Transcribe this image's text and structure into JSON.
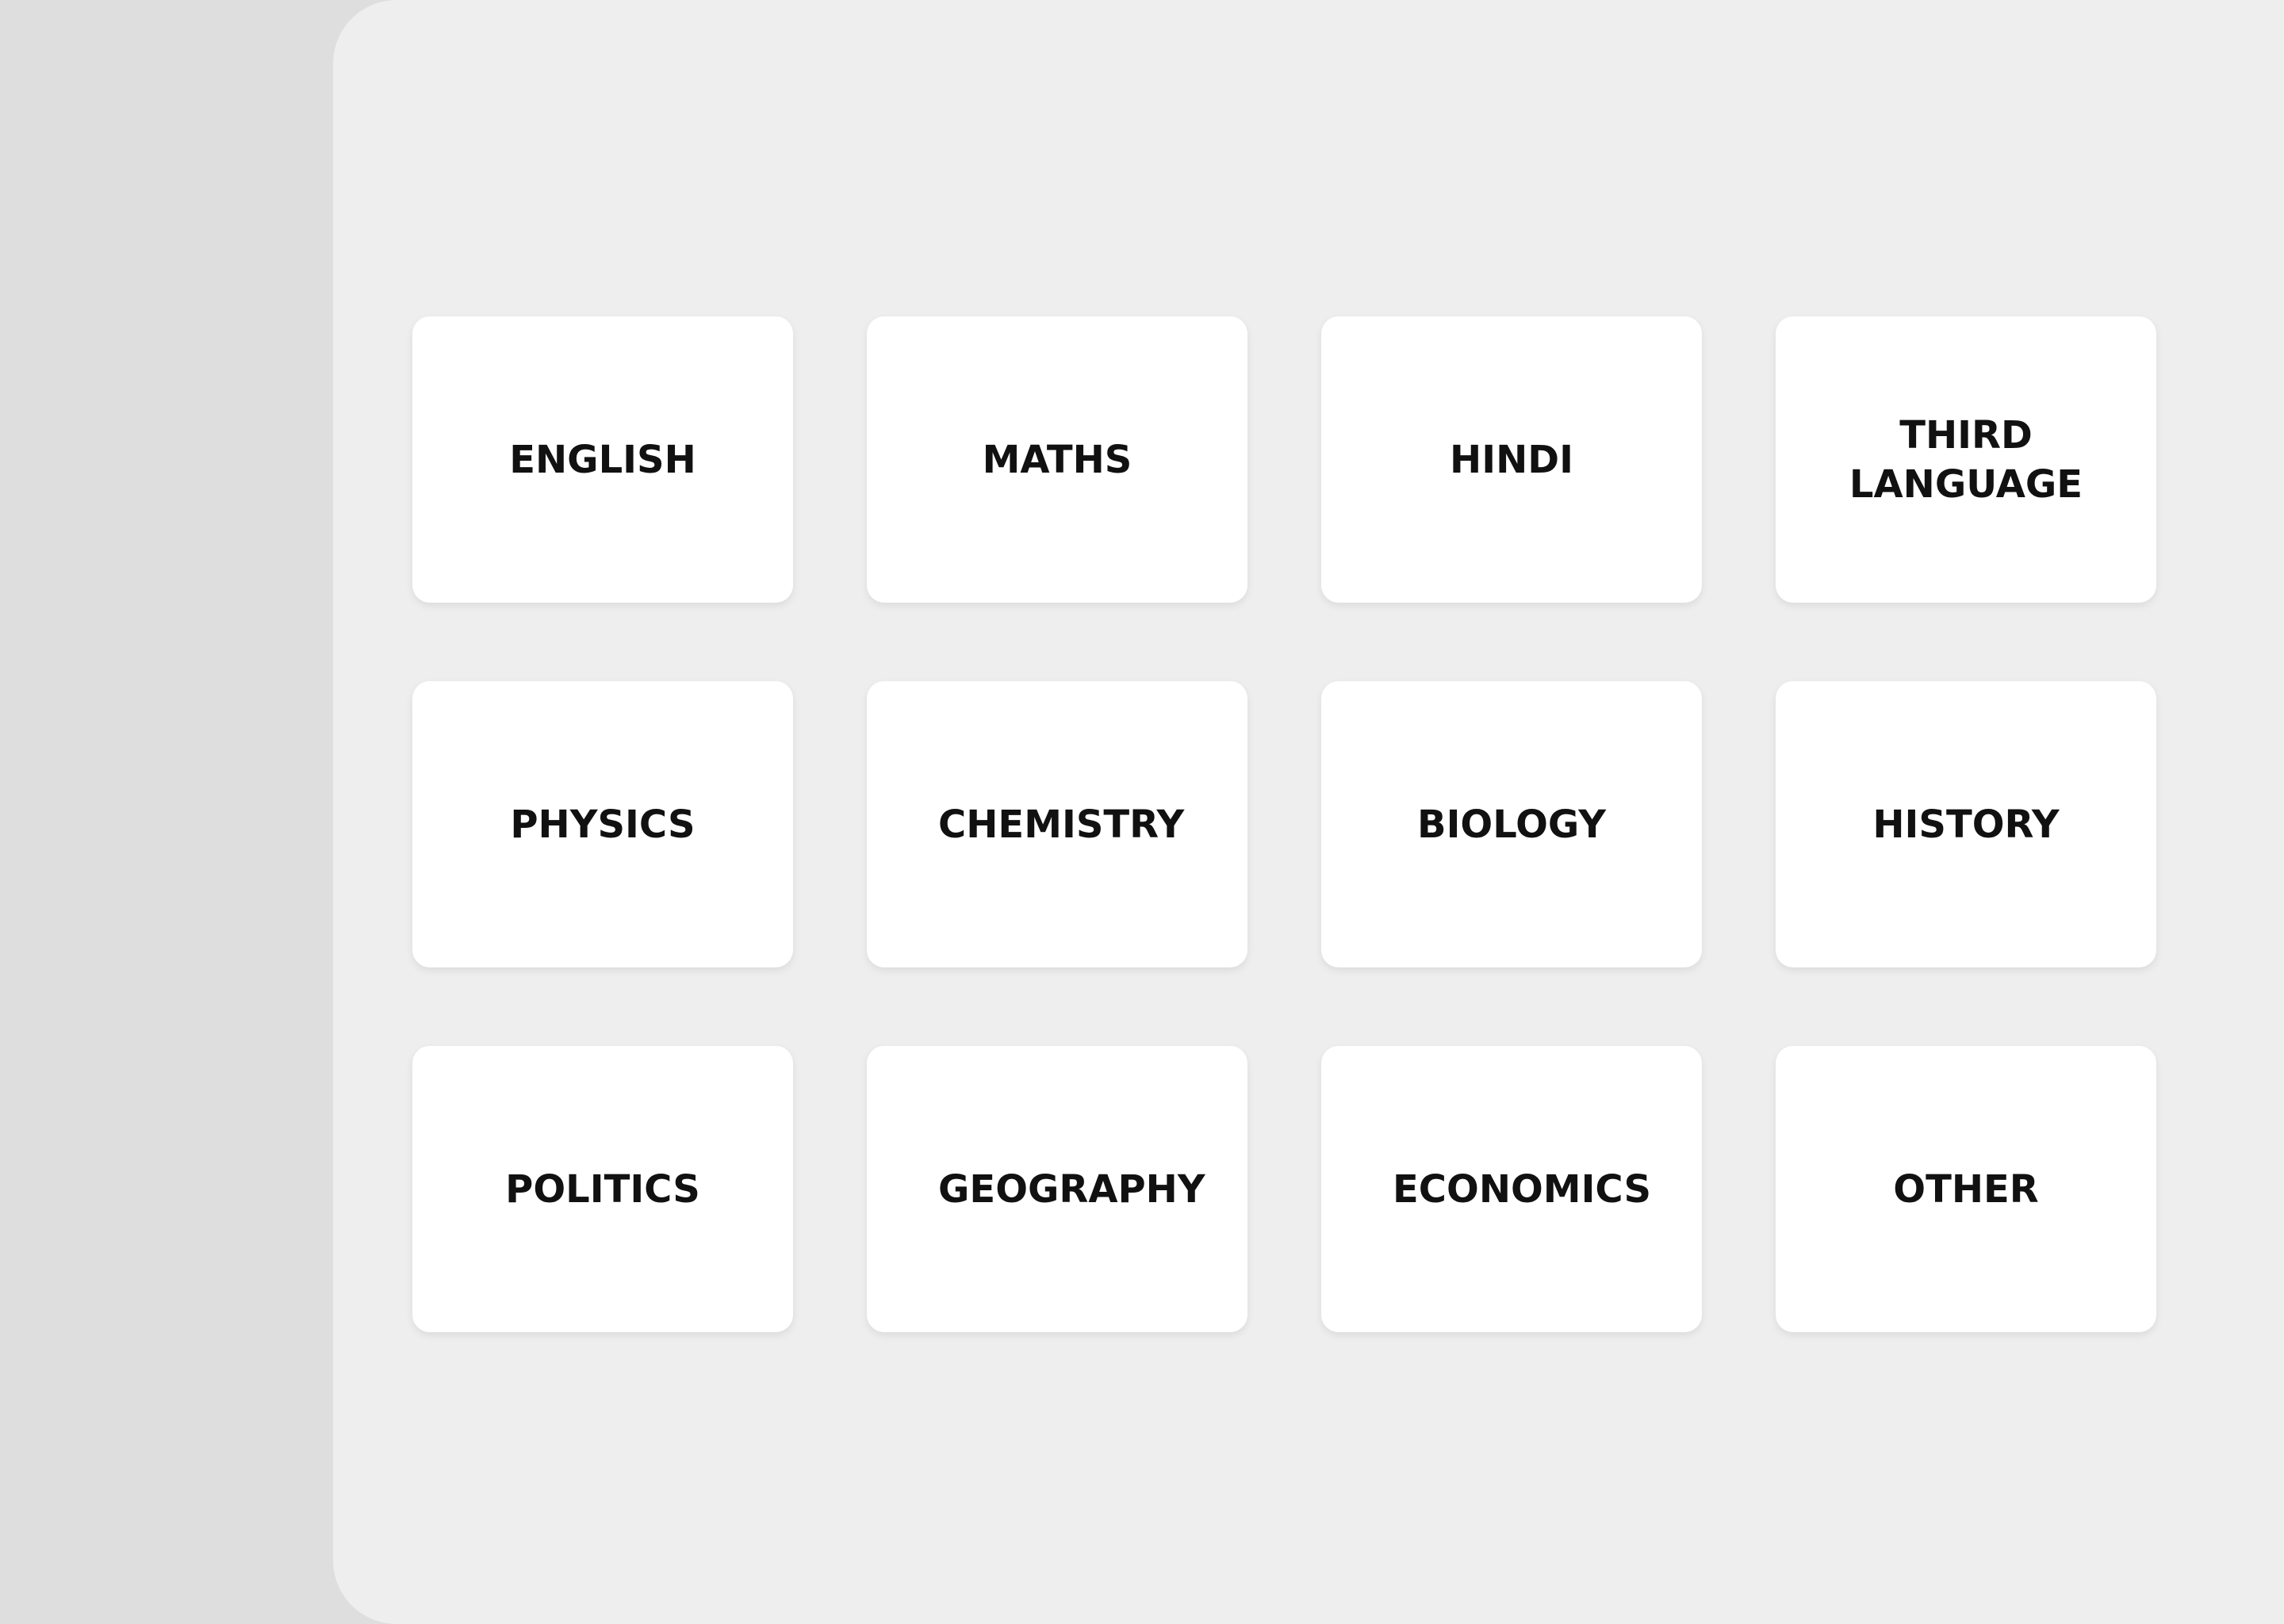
{
  "subjects": {
    "items": [
      {
        "label": "ENGLISH"
      },
      {
        "label": "MATHS"
      },
      {
        "label": "HINDI"
      },
      {
        "label": "THIRD LANGUAGE"
      },
      {
        "label": "PHYSICS"
      },
      {
        "label": "CHEMISTRY"
      },
      {
        "label": "BIOLOGY"
      },
      {
        "label": "HISTORY"
      },
      {
        "label": "POLITICS"
      },
      {
        "label": "GEOGRAPHY"
      },
      {
        "label": "ECONOMICS"
      },
      {
        "label": "OTHER"
      }
    ]
  },
  "colors": {
    "sidebar_bg": "#dedede",
    "panel_bg": "#eeeeee",
    "card_bg": "#ffffff",
    "text": "#111111"
  }
}
